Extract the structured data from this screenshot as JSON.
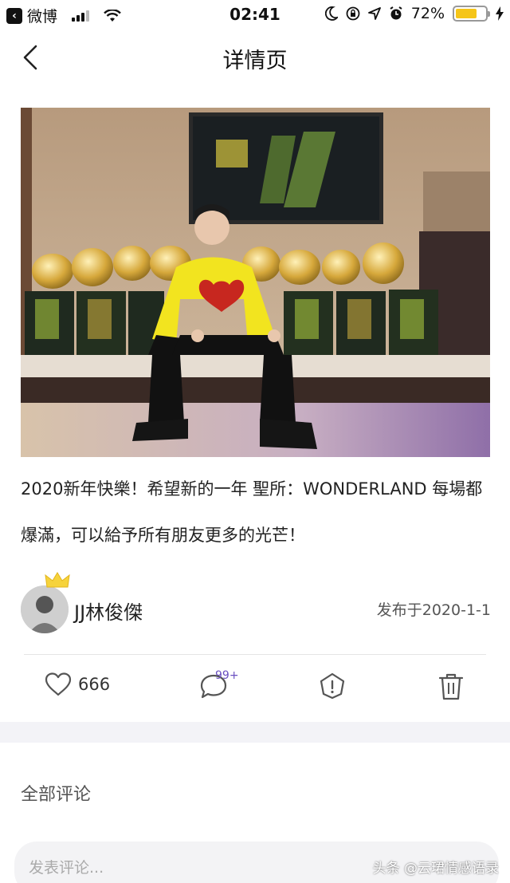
{
  "status_bar": {
    "back_app_label": "微博",
    "time": "02:41",
    "battery": "72%",
    "battery_color": "#f5c518"
  },
  "nav": {
    "title": "详情页",
    "back_icon": "chevron-left-icon"
  },
  "post": {
    "image_description_icon": "photo",
    "text": "2020新年快樂！希望新的一年 聖所：WONDERLAND 每場都爆滿，可以給予所有朋友更多的光芒！"
  },
  "author": {
    "name": "JJ林俊傑",
    "publish_date": "发布于2020-1-1"
  },
  "actions": {
    "like_count": "666",
    "comment_badge": "99+"
  },
  "comments": {
    "header": "全部评论",
    "input_placeholder": "发表评论..."
  },
  "watermark": "头条 @云珺情感语录"
}
